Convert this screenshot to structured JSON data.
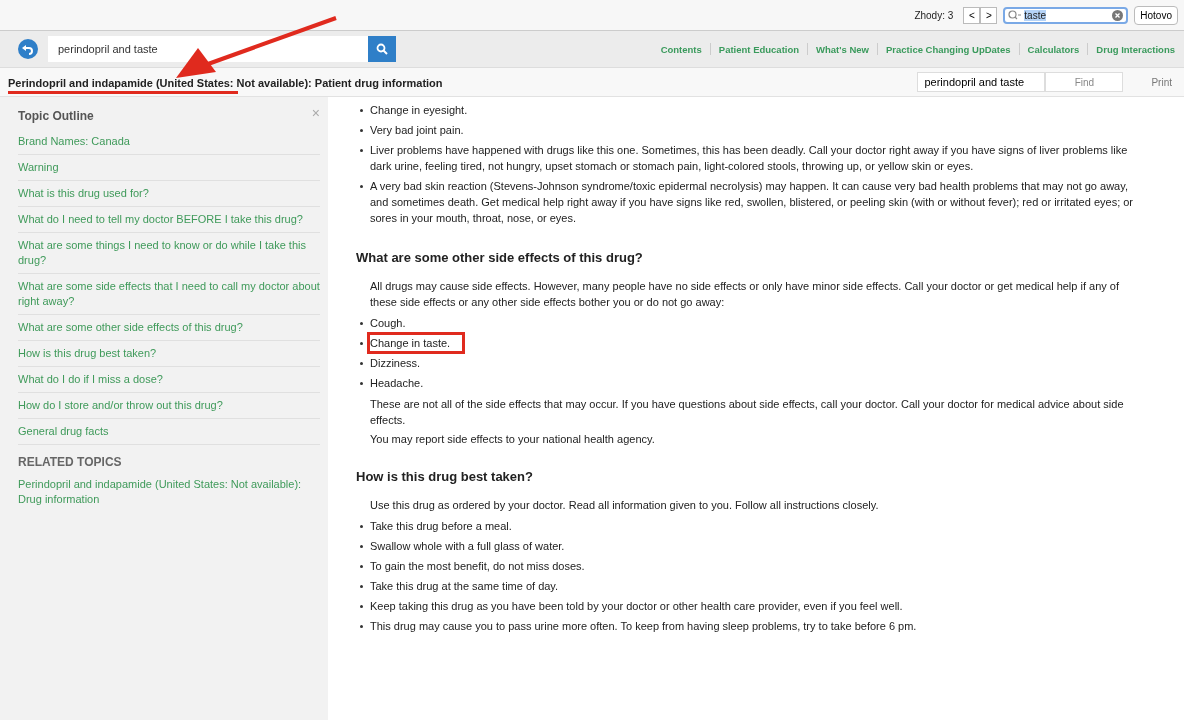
{
  "find_bar": {
    "matches": "Zhody: 3",
    "prev": "<",
    "next": ">",
    "query": "taste",
    "done": "Hotovo"
  },
  "toolbar": {
    "search_value": "perindopril and taste",
    "arrow_annotation": true,
    "links": [
      {
        "label": "Contents"
      },
      {
        "label": "Patient Education"
      },
      {
        "label": "What's New"
      },
      {
        "label": "Practice Changing UpDates"
      },
      {
        "label": "Calculators"
      },
      {
        "label": "Drug Interactions"
      }
    ]
  },
  "title_bar": {
    "title": "Perindopril and indapamide (United States: Not available): Patient drug information",
    "underlined": true,
    "find_value": "perindopril and taste",
    "find_button": "Find",
    "print": "Print"
  },
  "sidebar": {
    "heading": "Topic Outline",
    "close": "×",
    "items": [
      {
        "label": "Brand Names: Canada"
      },
      {
        "label": "Warning"
      },
      {
        "label": "What is this drug used for?"
      },
      {
        "label": "What do I need to tell my doctor BEFORE I take this drug?"
      },
      {
        "label": "What are some things I need to know or do while I take this drug?"
      },
      {
        "label": "What are some side effects that I need to call my doctor about right away?"
      },
      {
        "label": "What are some other side effects of this drug?"
      },
      {
        "label": "How is this drug best taken?"
      },
      {
        "label": "What do I do if I miss a dose?"
      },
      {
        "label": "How do I store and/or throw out this drug?"
      },
      {
        "label": "General drug facts"
      }
    ],
    "related_heading": "RELATED TOPICS",
    "related": [
      {
        "label": "Perindopril and indapamide (United States: Not available): Drug information"
      }
    ]
  },
  "content": [
    {
      "kind": "bullet",
      "text": "Change in eyesight.",
      "highlighted": false
    },
    {
      "kind": "bullet",
      "text": "Very bad joint pain.",
      "highlighted": false
    },
    {
      "kind": "bullet",
      "text": "Liver problems have happened with drugs like this one. Sometimes, this has been deadly. Call your doctor right away if you have signs of liver problems like dark urine, feeling tired, not hungry, upset stomach or stomach pain, light-colored stools, throwing up, or yellow skin or eyes.",
      "highlighted": false
    },
    {
      "kind": "bullet",
      "text": "A very bad skin reaction (Stevens-Johnson syndrome/toxic epidermal necrolysis) may happen. It can cause very bad health problems that may not go away, and sometimes death. Get medical help right away if you have signs like red, swollen, blistered, or peeling skin (with or without fever); red or irritated eyes; or sores in your mouth, throat, nose, or eyes.",
      "highlighted": false
    },
    {
      "kind": "heading",
      "text": "What are some other side effects of this drug?"
    },
    {
      "kind": "paragraph",
      "text": "All drugs may cause side effects. However, many people have no side effects or only have minor side effects. Call your doctor or get medical help if any of these side effects or any other side effects bother you or do not go away:"
    },
    {
      "kind": "bullet",
      "text": "Cough.",
      "highlighted": false
    },
    {
      "kind": "bullet",
      "text": "Change in taste.",
      "highlighted": true
    },
    {
      "kind": "bullet",
      "text": "Dizziness.",
      "highlighted": false
    },
    {
      "kind": "bullet",
      "text": "Headache.",
      "highlighted": false
    },
    {
      "kind": "paragraph",
      "text": "These are not all of the side effects that may occur. If you have questions about side effects, call your doctor. Call your doctor for medical advice about side effects."
    },
    {
      "kind": "paragraph",
      "text": "You may report side effects to your national health agency."
    },
    {
      "kind": "heading",
      "text": "How is this drug best taken?"
    },
    {
      "kind": "paragraph",
      "text": "Use this drug as ordered by your doctor. Read all information given to you. Follow all instructions closely."
    },
    {
      "kind": "bullet",
      "text": "Take this drug before a meal.",
      "highlighted": false
    },
    {
      "kind": "bullet",
      "text": "Swallow whole with a full glass of water.",
      "highlighted": false
    },
    {
      "kind": "bullet",
      "text": "To gain the most benefit, do not miss doses.",
      "highlighted": false
    },
    {
      "kind": "bullet",
      "text": "Take this drug at the same time of day.",
      "highlighted": false
    },
    {
      "kind": "bullet",
      "text": "Keep taking this drug as you have been told by your doctor or other health care provider, even if you feel well.",
      "highlighted": false
    },
    {
      "kind": "bullet",
      "text": "This drug may cause you to pass urine more often. To keep from having sleep problems, try to take before 6 pm.",
      "highlighted": false
    }
  ]
}
